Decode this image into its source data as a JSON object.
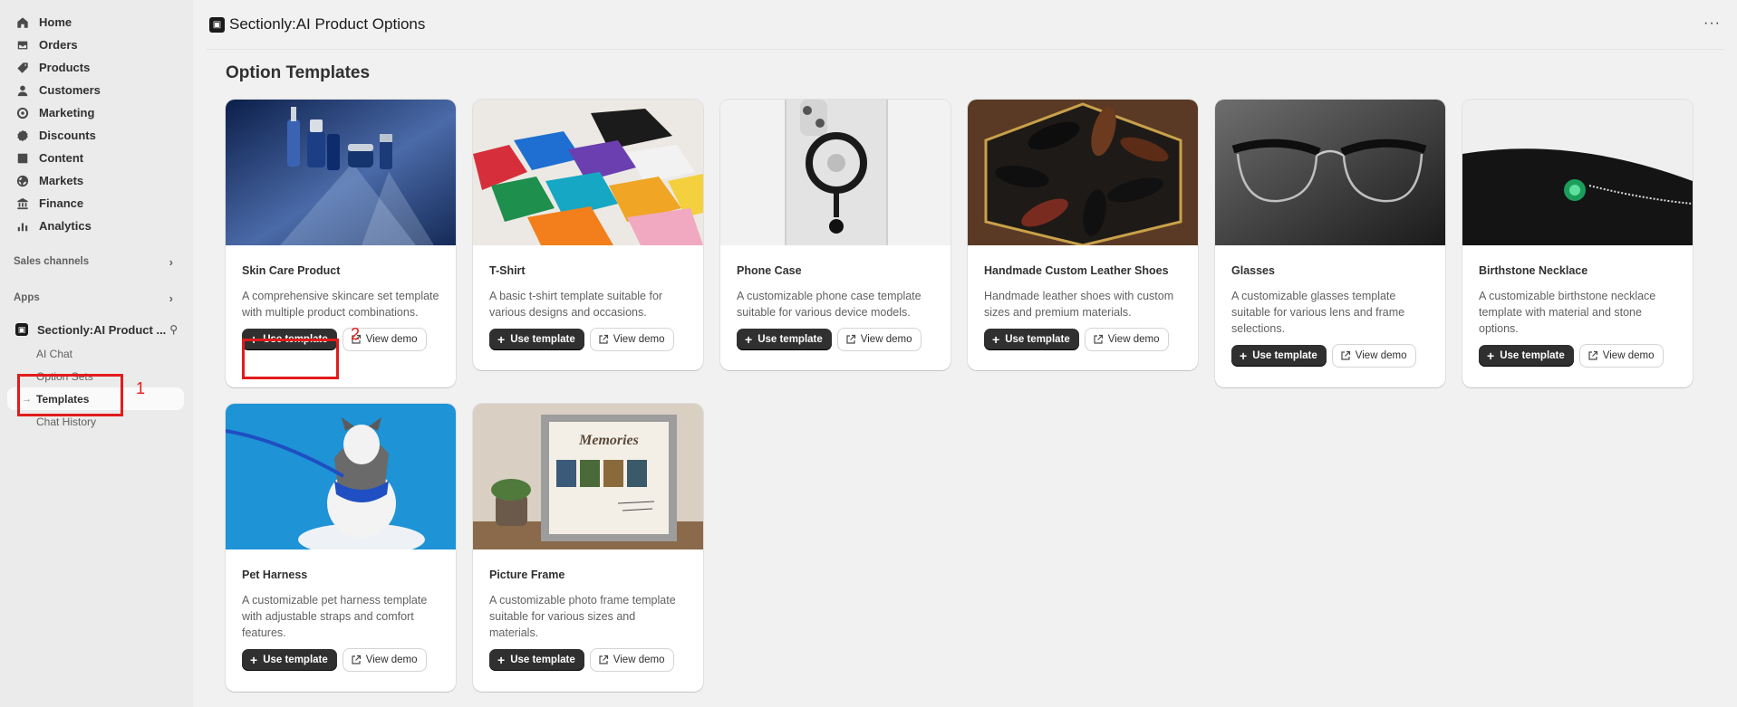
{
  "sidebar": {
    "nav": [
      {
        "label": "Home",
        "icon": "home-icon"
      },
      {
        "label": "Orders",
        "icon": "orders-icon"
      },
      {
        "label": "Products",
        "icon": "tag-icon"
      },
      {
        "label": "Customers",
        "icon": "person-icon"
      },
      {
        "label": "Marketing",
        "icon": "target-icon"
      },
      {
        "label": "Discounts",
        "icon": "discount-icon"
      },
      {
        "label": "Content",
        "icon": "content-icon"
      },
      {
        "label": "Markets",
        "icon": "globe-icon"
      },
      {
        "label": "Finance",
        "icon": "bank-icon"
      },
      {
        "label": "Analytics",
        "icon": "bar-chart-icon"
      }
    ],
    "sales_channels": "Sales channels",
    "apps": "Apps",
    "app_name": "Sectionly:AI Product ...",
    "app_subitems": [
      "AI Chat",
      "Option Sets",
      "Templates",
      "Chat History"
    ],
    "active_subitem": "Templates"
  },
  "header": {
    "title": "Sectionly:AI Product Options",
    "more": "···"
  },
  "main": {
    "heading": "Option Templates",
    "use_template_label": "Use template",
    "view_demo_label": "View demo",
    "cards": [
      {
        "title": "Skin Care Product",
        "desc": "A comprehensive skincare set template with multiple product combinations."
      },
      {
        "title": "T-Shirt",
        "desc": "A basic t-shirt template suitable for various designs and occasions."
      },
      {
        "title": "Phone Case",
        "desc": "A customizable phone case template suitable for various device models."
      },
      {
        "title": "Handmade Custom Leather Shoes",
        "desc": "Handmade leather shoes with custom sizes and premium materials."
      },
      {
        "title": "Glasses",
        "desc": "A customizable glasses template suitable for various lens and frame selections."
      },
      {
        "title": "Birthstone Necklace",
        "desc": "A customizable birthstone necklace template with material and stone options."
      },
      {
        "title": "Pet Harness",
        "desc": "A customizable pet harness template with adjustable straps and comfort features."
      },
      {
        "title": "Picture Frame",
        "desc": "A customizable photo frame template suitable for various sizes and materials."
      }
    ],
    "frame_text": "Memories"
  },
  "annotations": {
    "one": "1",
    "two": "2"
  },
  "colors": {
    "annotation": "#e21b1b",
    "primary_button": "#303030",
    "sidebar_bg": "#ebebeb"
  }
}
